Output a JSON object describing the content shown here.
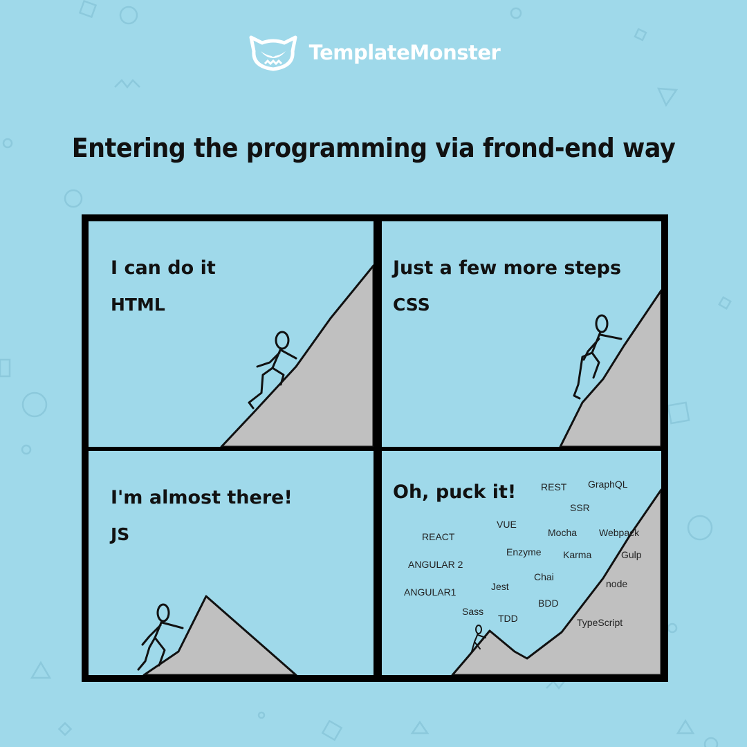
{
  "brand": {
    "name": "TemplateMonster",
    "logo_icon": "monster-cat-icon",
    "color": "#ffffff"
  },
  "title": "Entering the programming via frond-end way",
  "colors": {
    "background": "#9fd9ea",
    "mountain": "#c0c0c0",
    "border": "#000000"
  },
  "panels": [
    {
      "caption": "I can do it",
      "tech": "HTML"
    },
    {
      "caption": "Just a few more steps",
      "tech": "CSS"
    },
    {
      "caption": "I'm almost there!",
      "tech": "JS"
    },
    {
      "caption": "Oh, puck it!",
      "tags": [
        "REST",
        "GraphQL",
        "SSR",
        "VUE",
        "REACT",
        "Mocha",
        "Webpack",
        "Enzyme",
        "Karma",
        "Gulp",
        "ANGULAR 2",
        "Chai",
        "node",
        "Jest",
        "ANGULAR1",
        "BDD",
        "Sass",
        "TDD",
        "TypeScript"
      ]
    }
  ]
}
